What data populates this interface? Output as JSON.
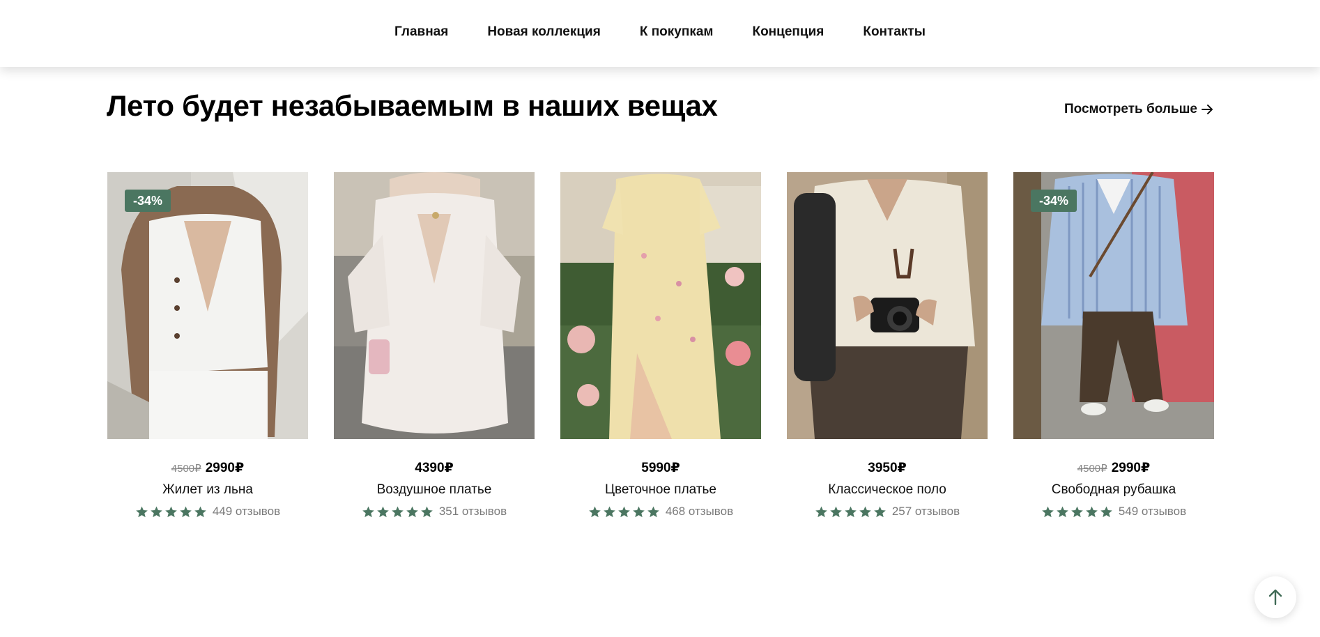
{
  "nav": {
    "items": [
      {
        "label": "Главная"
      },
      {
        "label": "Новая коллекция"
      },
      {
        "label": "К покупкам"
      },
      {
        "label": "Концепция"
      },
      {
        "label": "Контакты"
      }
    ]
  },
  "section": {
    "title": "Лето будет незабываемым в наших вещах",
    "more_label": "Посмотреть больше"
  },
  "colors": {
    "accent": "#4b7661",
    "text": "#000000",
    "muted": "#7a7a7a"
  },
  "products": [
    {
      "badge": "-34%",
      "old_price": "4500₽",
      "price": "2990₽",
      "name": "Жилет из льна",
      "rating": 5,
      "reviews": "449 отзывов",
      "image": "white-linen-vest-photo"
    },
    {
      "badge": "",
      "old_price": "",
      "price": "4390₽",
      "name": "Воздушное платье",
      "rating": 5,
      "reviews": "351 отзывов",
      "image": "white-ruffle-dress-photo"
    },
    {
      "badge": "",
      "old_price": "",
      "price": "5990₽",
      "name": "Цветочное платье",
      "rating": 5,
      "reviews": "468 отзывов",
      "image": "floral-dress-photo"
    },
    {
      "badge": "",
      "old_price": "",
      "price": "3950₽",
      "name": "Классическое поло",
      "rating": 5,
      "reviews": "257 отзывов",
      "image": "classic-polo-photo"
    },
    {
      "badge": "-34%",
      "old_price": "4500₽",
      "price": "2990₽",
      "name": "Свободная рубашка",
      "rating": 5,
      "reviews": "549 отзывов",
      "image": "striped-shirt-photo"
    }
  ],
  "icons": {
    "more_arrow": "arrow-right-icon",
    "star": "star-icon",
    "scroll_top": "arrow-up-icon"
  }
}
